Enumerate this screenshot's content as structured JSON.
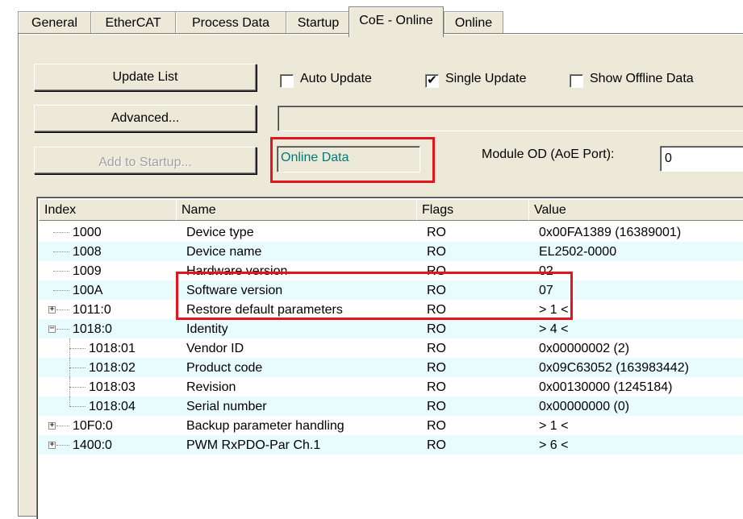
{
  "tabs": [
    {
      "label": "General"
    },
    {
      "label": "EtherCAT"
    },
    {
      "label": "Process Data"
    },
    {
      "label": "Startup"
    },
    {
      "label": "CoE - Online"
    },
    {
      "label": "Online"
    }
  ],
  "buttons": {
    "update_list": "Update List",
    "advanced": "Advanced...",
    "add_to_startup": "Add to Startup..."
  },
  "checkboxes": {
    "auto_update": {
      "label": "Auto Update",
      "checked": false
    },
    "single_update": {
      "label": "Single Update",
      "checked": true
    },
    "show_offline": {
      "label": "Show Offline Data",
      "checked": false
    }
  },
  "status": {
    "text": "Online Data",
    "color": "#007a7a"
  },
  "module_od": {
    "label": "Module OD (AoE Port):",
    "value": "0"
  },
  "columns": [
    "Index",
    "Name",
    "Flags",
    "Value"
  ],
  "rows": [
    {
      "index": "1000",
      "name": "Device type",
      "flags": "RO",
      "value": "0x00FA1389 (16389001)"
    },
    {
      "index": "1008",
      "name": "Device name",
      "flags": "RO",
      "value": "EL2502-0000"
    },
    {
      "index": "1009",
      "name": "Hardware version",
      "flags": "RO",
      "value": "02"
    },
    {
      "index": "100A",
      "name": "Software version",
      "flags": "RO",
      "value": "07"
    },
    {
      "index": "1011:0",
      "name": "Restore default parameters",
      "flags": "RO",
      "value": "> 1 <"
    },
    {
      "index": "1018:0",
      "name": "Identity",
      "flags": "RO",
      "value": "> 4 <"
    },
    {
      "index": "1018:01",
      "name": "Vendor ID",
      "flags": "RO",
      "value": "0x00000002 (2)"
    },
    {
      "index": "1018:02",
      "name": "Product code",
      "flags": "RO",
      "value": "0x09C63052 (163983442)"
    },
    {
      "index": "1018:03",
      "name": "Revision",
      "flags": "RO",
      "value": "0x00130000 (1245184)"
    },
    {
      "index": "1018:04",
      "name": "Serial number",
      "flags": "RO",
      "value": "0x00000000 (0)"
    },
    {
      "index": "10F0:0",
      "name": "Backup parameter handling",
      "flags": "RO",
      "value": "> 1 <"
    },
    {
      "index": "1400:0",
      "name": "PWM RxPDO-Par Ch.1",
      "flags": "RO",
      "value": "> 6 <"
    }
  ],
  "expander_symbols": {
    "collapsed": "+",
    "expanded": "−"
  },
  "highlight_color": "#e3141e"
}
